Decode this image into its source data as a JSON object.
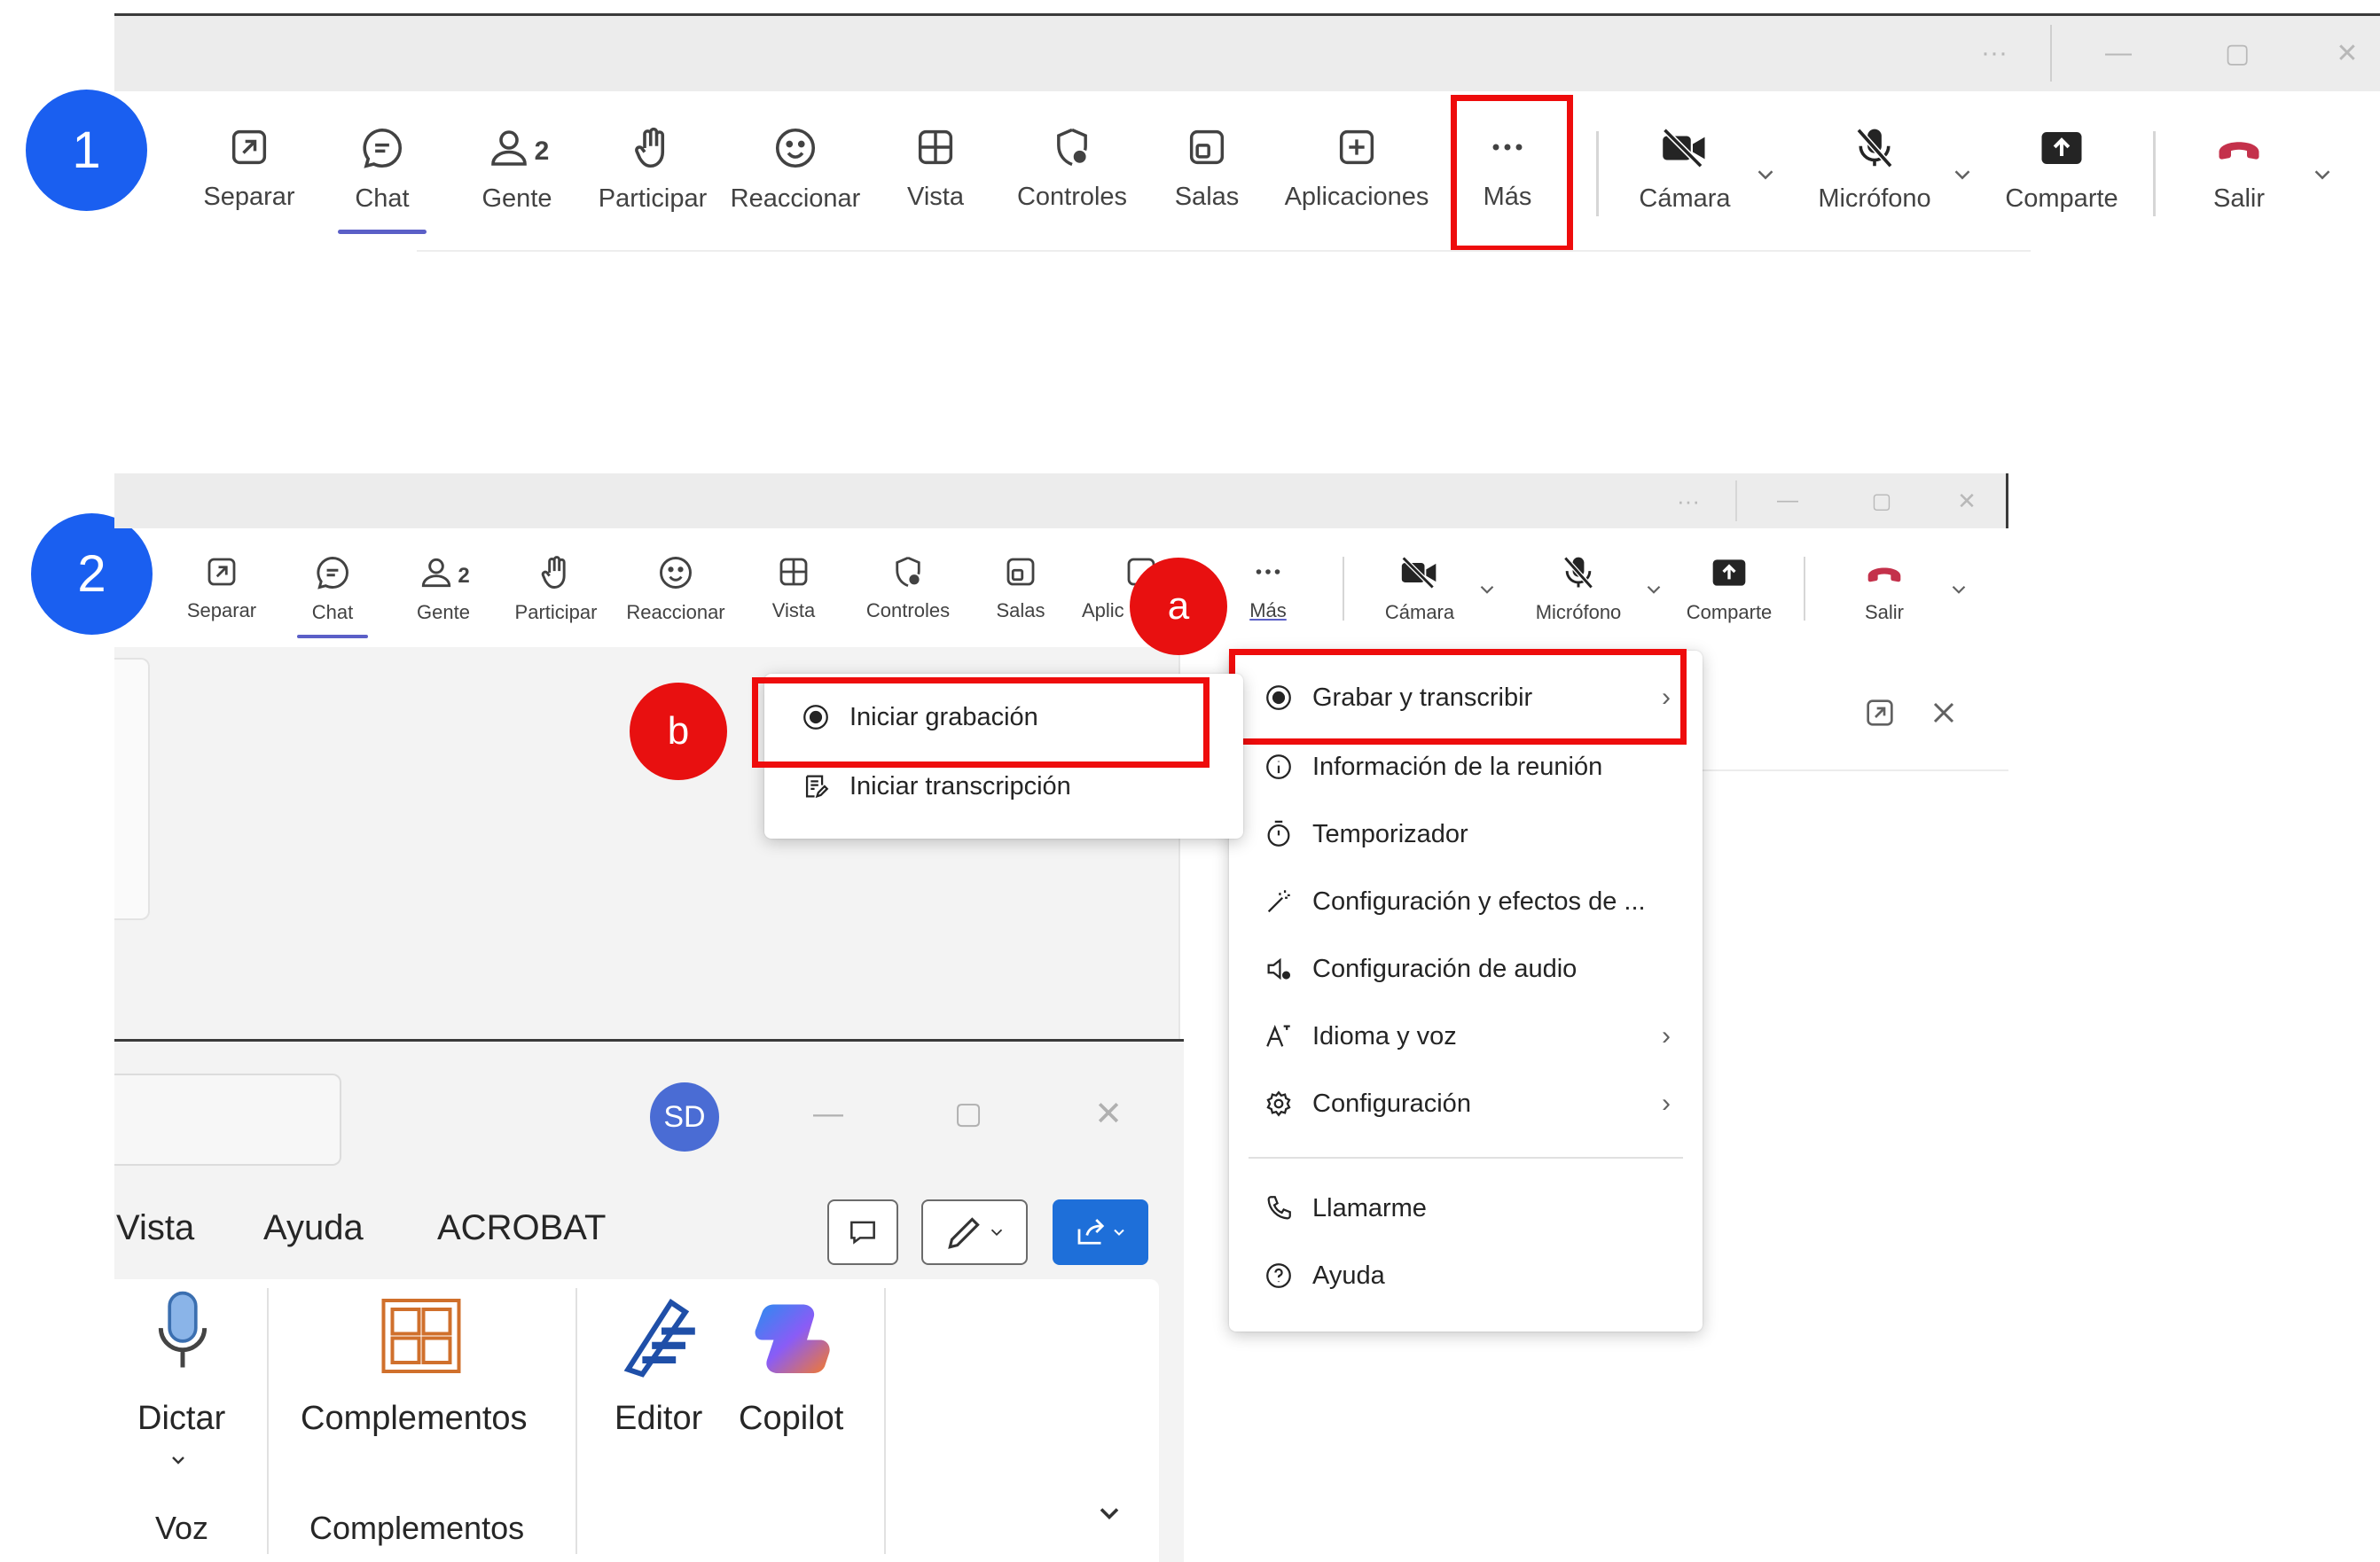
{
  "steps": {
    "one": "1",
    "two": "2",
    "a": "a",
    "b": "b"
  },
  "toolbar_top": {
    "separar": "Separar",
    "chat": "Chat",
    "gente": "Gente",
    "gente_count": "2",
    "participar": "Participar",
    "reaccionar": "Reaccionar",
    "vista": "Vista",
    "controles": "Controles",
    "salas": "Salas",
    "aplicaciones": "Aplicaciones",
    "mas": "Más",
    "camara": "Cámara",
    "microfono": "Micrófono",
    "comparte": "Comparte",
    "salir": "Salir"
  },
  "toolbar_bottom": {
    "separar": "Separar",
    "chat": "Chat",
    "gente": "Gente",
    "gente_count": "2",
    "participar": "Participar",
    "reaccionar": "Reaccionar",
    "vista": "Vista",
    "controles": "Controles",
    "salas": "Salas",
    "aplicaciones_partial": "Aplic",
    "mas": "Más",
    "camara": "Cámara",
    "microfono": "Micrófono",
    "comparte": "Comparte",
    "salir": "Salir"
  },
  "more_menu": {
    "items": [
      {
        "label": "Grabar y transcribir",
        "icon": "record-icon",
        "submenu": true
      },
      {
        "label": "Información de la reunión",
        "icon": "info-icon",
        "submenu": false
      },
      {
        "label": "Temporizador",
        "icon": "timer-icon",
        "submenu": false
      },
      {
        "label": "Configuración y efectos de ...",
        "icon": "magic-wand-icon",
        "submenu": false
      },
      {
        "label": "Configuración de audio",
        "icon": "speaker-settings-icon",
        "submenu": false
      },
      {
        "label": "Idioma y voz",
        "icon": "language-icon",
        "submenu": true
      },
      {
        "label": "Configuración",
        "icon": "gear-icon",
        "submenu": true
      },
      {
        "label": "Llamarme",
        "icon": "phone-icon",
        "submenu": false
      },
      {
        "label": "Ayuda",
        "icon": "help-icon",
        "submenu": false
      }
    ]
  },
  "record_submenu": {
    "start_recording": "Iniciar grabación",
    "start_transcription": "Iniciar transcripción"
  },
  "word_window": {
    "avatar_initials": "SD",
    "tabs": {
      "vista": "Vista",
      "ayuda": "Ayuda",
      "acrobat": "ACROBAT"
    },
    "ribbon": {
      "dictar": "Dictar",
      "complementos_btn": "Complementos",
      "editor": "Editor",
      "copilot": "Copilot",
      "group_voz": "Voz",
      "group_complementos": "Complementos"
    }
  },
  "colors": {
    "accent": "#5b5fc7",
    "highlight": "#ee0c0c",
    "badge_blue": "#1a5ff0",
    "leave_red": "#c4314b"
  }
}
